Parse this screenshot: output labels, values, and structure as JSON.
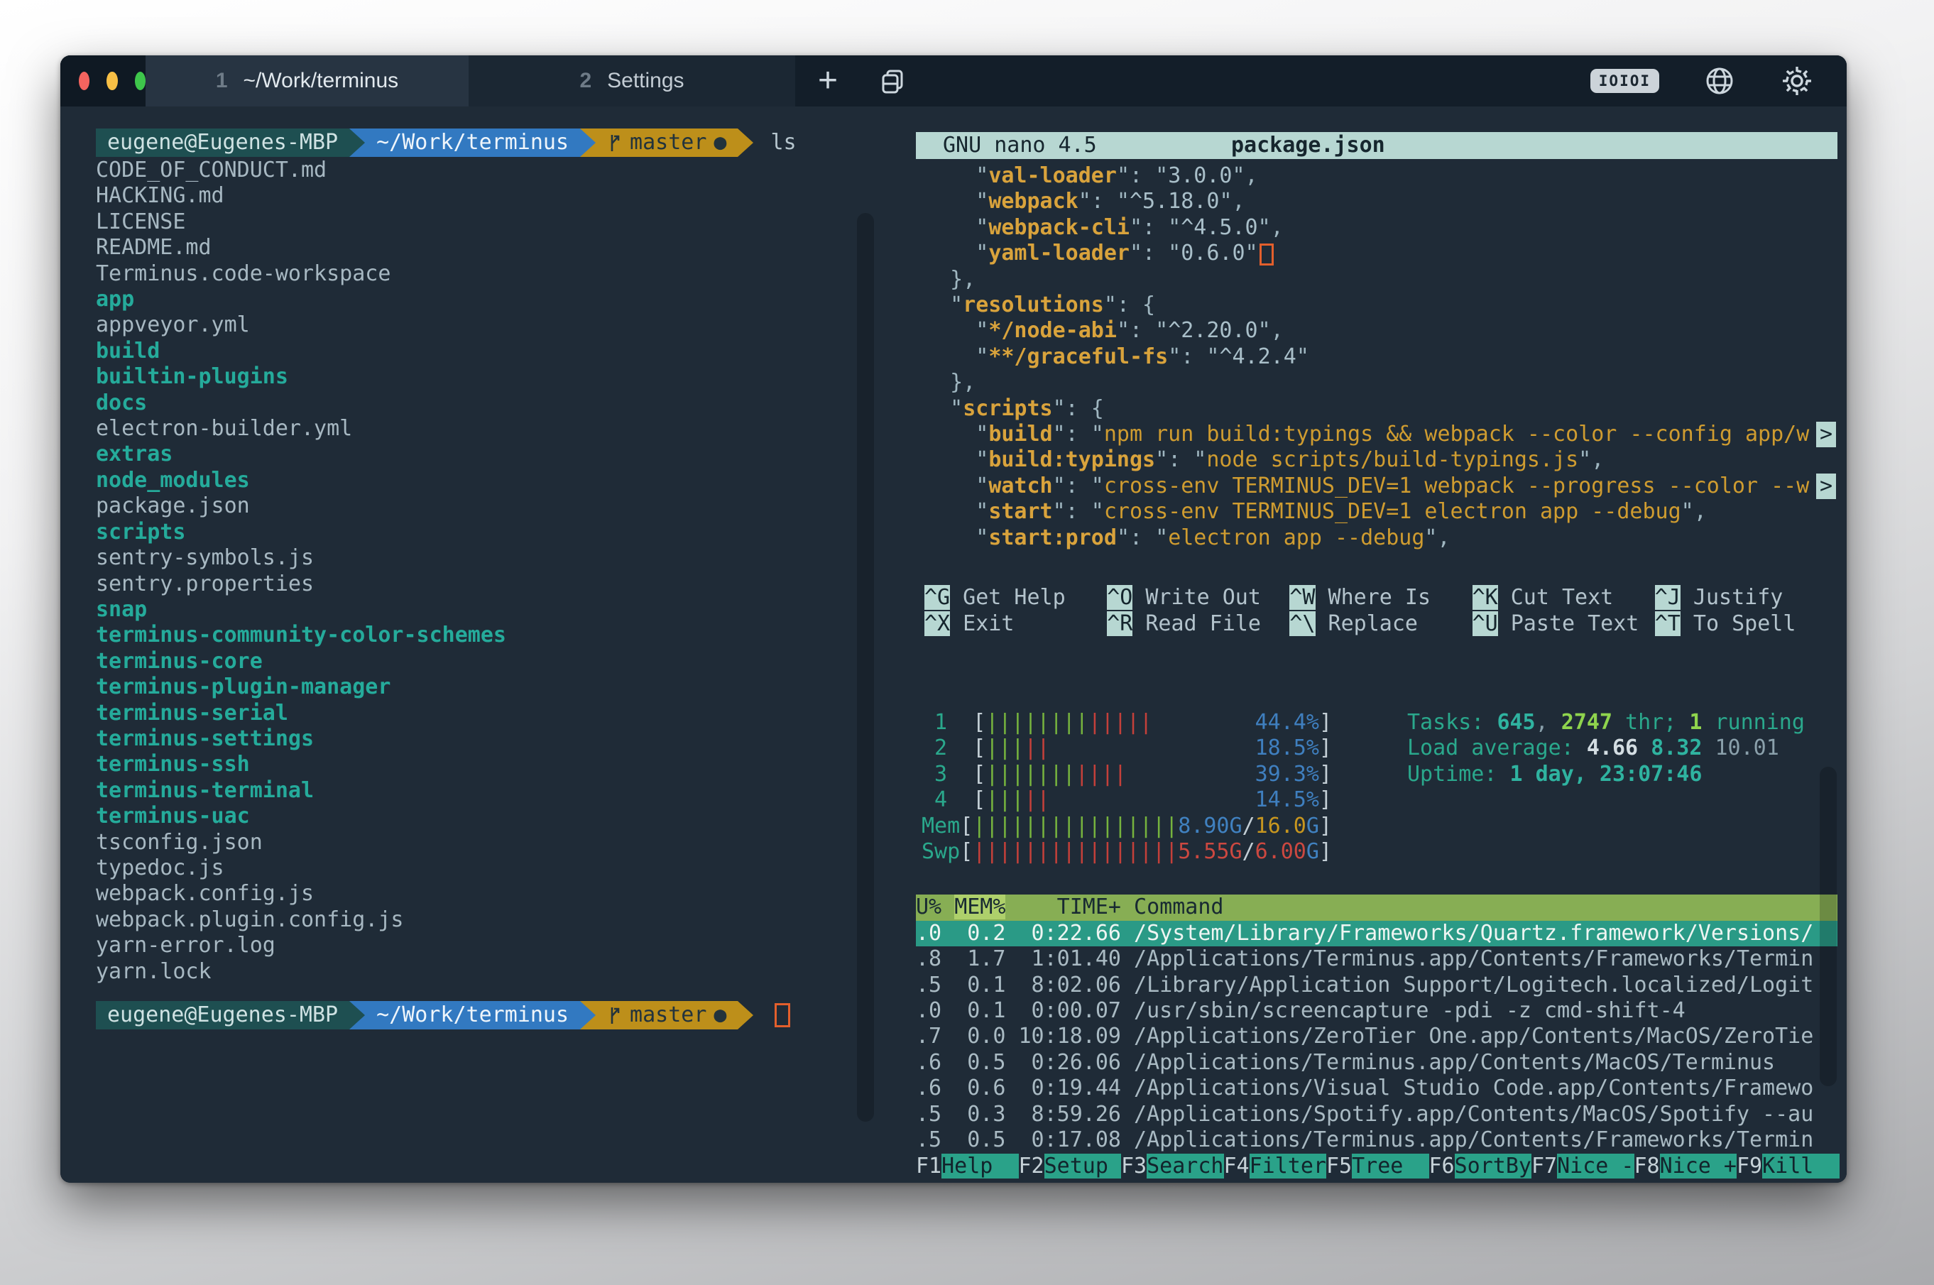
{
  "colors": {
    "accent_teal": "#2aa889",
    "gold": "#bd8f1a",
    "key_gold": "#d9a33c",
    "blue": "#3279c1",
    "red": "#c4403a",
    "green": "#76b33e",
    "bright_green": "#8fd44d",
    "steel_blue": "#3f7fbf",
    "nano_bar": "#b7d7d2",
    "selected_row": "#2a9a86",
    "header_green": "#87ae54",
    "cursor_orange": "#e35f2c",
    "window_bg": "#1f2b37"
  },
  "window": {
    "controls": [
      "close",
      "minimize",
      "zoom"
    ],
    "tabs": [
      {
        "index": "1",
        "label": "~/Work/terminus",
        "active": true
      },
      {
        "index": "2",
        "label": "Settings",
        "active": false
      }
    ],
    "new_tab_label": "+",
    "icons": {
      "serial_badge": "IOIOI",
      "globe": "globe",
      "gear": "settings"
    }
  },
  "shell": {
    "prompt": {
      "user": "eugene@Eugenes-MBP",
      "cwd": "~/Work/terminus",
      "git_branch": "master",
      "git_dirty_dot": "●"
    },
    "command": "ls",
    "listing": [
      {
        "name": "CODE_OF_CONDUCT.md",
        "type": "file"
      },
      {
        "name": "HACKING.md",
        "type": "file"
      },
      {
        "name": "LICENSE",
        "type": "file"
      },
      {
        "name": "README.md",
        "type": "file"
      },
      {
        "name": "Terminus.code-workspace",
        "type": "file"
      },
      {
        "name": "app",
        "type": "dir"
      },
      {
        "name": "appveyor.yml",
        "type": "file"
      },
      {
        "name": "build",
        "type": "dir"
      },
      {
        "name": "builtin-plugins",
        "type": "dir"
      },
      {
        "name": "docs",
        "type": "dir"
      },
      {
        "name": "electron-builder.yml",
        "type": "file"
      },
      {
        "name": "extras",
        "type": "dir"
      },
      {
        "name": "node_modules",
        "type": "dir"
      },
      {
        "name": "package.json",
        "type": "file"
      },
      {
        "name": "scripts",
        "type": "dir"
      },
      {
        "name": "sentry-symbols.js",
        "type": "file"
      },
      {
        "name": "sentry.properties",
        "type": "file"
      },
      {
        "name": "snap",
        "type": "dir"
      },
      {
        "name": "terminus-community-color-schemes",
        "type": "dir"
      },
      {
        "name": "terminus-core",
        "type": "dir"
      },
      {
        "name": "terminus-plugin-manager",
        "type": "dir"
      },
      {
        "name": "terminus-serial",
        "type": "dir"
      },
      {
        "name": "terminus-settings",
        "type": "dir"
      },
      {
        "name": "terminus-ssh",
        "type": "dir"
      },
      {
        "name": "terminus-terminal",
        "type": "dir"
      },
      {
        "name": "terminus-uac",
        "type": "dir"
      },
      {
        "name": "tsconfig.json",
        "type": "file"
      },
      {
        "name": "typedoc.js",
        "type": "file"
      },
      {
        "name": "webpack.config.js",
        "type": "file"
      },
      {
        "name": "webpack.plugin.config.js",
        "type": "file"
      },
      {
        "name": "yarn-error.log",
        "type": "file"
      },
      {
        "name": "yarn.lock",
        "type": "file"
      }
    ]
  },
  "nano": {
    "title_left": "GNU nano 4.5",
    "title_file": "package.json",
    "lines": [
      [
        [
          "q",
          "    \""
        ],
        [
          "k",
          "val-loader"
        ],
        [
          "q",
          "\": \""
        ],
        [
          "v",
          "3.0.0"
        ],
        [
          "q",
          "\","
        ]
      ],
      [
        [
          "q",
          "    \""
        ],
        [
          "k",
          "webpack"
        ],
        [
          "q",
          "\": \""
        ],
        [
          "v",
          "^5.18.0"
        ],
        [
          "q",
          "\","
        ]
      ],
      [
        [
          "q",
          "    \""
        ],
        [
          "k",
          "webpack-cli"
        ],
        [
          "q",
          "\": \""
        ],
        [
          "v",
          "^4.5.0"
        ],
        [
          "q",
          "\","
        ]
      ],
      [
        [
          "q",
          "    \""
        ],
        [
          "k",
          "yaml-loader"
        ],
        [
          "q",
          "\": \""
        ],
        [
          "v",
          "0.6.0"
        ],
        [
          "q",
          "\""
        ],
        [
          "cursor",
          ""
        ]
      ],
      [
        [
          "q",
          "  },"
        ]
      ],
      [
        [
          "q",
          "  \""
        ],
        [
          "k",
          "resolutions"
        ],
        [
          "q",
          "\": {"
        ]
      ],
      [
        [
          "q",
          "    \""
        ],
        [
          "k",
          "*/node-abi"
        ],
        [
          "q",
          "\": \""
        ],
        [
          "v",
          "^2.20.0"
        ],
        [
          "q",
          "\","
        ]
      ],
      [
        [
          "q",
          "    \""
        ],
        [
          "k",
          "**/graceful-fs"
        ],
        [
          "q",
          "\": \""
        ],
        [
          "v",
          "^4.2.4"
        ],
        [
          "q",
          "\""
        ]
      ],
      [
        [
          "q",
          "  },"
        ]
      ],
      [
        [
          "q",
          "  \""
        ],
        [
          "k",
          "scripts"
        ],
        [
          "q",
          "\": {"
        ]
      ],
      [
        [
          "q",
          "    \""
        ],
        [
          "k",
          "build"
        ],
        [
          "q",
          "\": \""
        ],
        [
          "g",
          "npm run build:typings && webpack --color --config app/w"
        ],
        [
          "cont",
          ""
        ]
      ],
      [
        [
          "q",
          "    \""
        ],
        [
          "k",
          "build:typings"
        ],
        [
          "q",
          "\": \""
        ],
        [
          "g",
          "node scripts/build-typings.js"
        ],
        [
          "q",
          "\","
        ]
      ],
      [
        [
          "q",
          "    \""
        ],
        [
          "k",
          "watch"
        ],
        [
          "q",
          "\": \""
        ],
        [
          "g",
          "cross-env TERMINUS_DEV=1 webpack --progress --color --w"
        ],
        [
          "cont",
          ""
        ]
      ],
      [
        [
          "q",
          "    \""
        ],
        [
          "k",
          "start"
        ],
        [
          "q",
          "\": \""
        ],
        [
          "g",
          "cross-env TERMINUS_DEV=1 electron app --debug"
        ],
        [
          "q",
          "\","
        ]
      ],
      [
        [
          "q",
          "    \""
        ],
        [
          "k",
          "start:prod"
        ],
        [
          "q",
          "\": \""
        ],
        [
          "g",
          "electron app --debug"
        ],
        [
          "q",
          "\","
        ]
      ]
    ],
    "shortcuts": [
      [
        {
          "key": "^G",
          "label": "Get Help"
        },
        {
          "key": "^O",
          "label": "Write Out"
        },
        {
          "key": "^W",
          "label": "Where Is"
        },
        {
          "key": "^K",
          "label": "Cut Text"
        },
        {
          "key": "^J",
          "label": "Justify"
        }
      ],
      [
        {
          "key": "^X",
          "label": "Exit"
        },
        {
          "key": "^R",
          "label": "Read File"
        },
        {
          "key": "^\\",
          "label": "Replace"
        },
        {
          "key": "^U",
          "label": "Paste Text"
        },
        {
          "key": "^T",
          "label": "To Spell"
        }
      ]
    ]
  },
  "htop": {
    "meters": [
      {
        "parts": [
          [
            "L",
            " 1  "
          ],
          [
            "W",
            "["
          ],
          [
            "G",
            "||||||||"
          ],
          [
            "R",
            "|||||"
          ],
          [
            "W",
            "        "
          ],
          [
            "P",
            "44.4%"
          ],
          [
            "W",
            "]"
          ]
        ]
      },
      {
        "parts": [
          [
            "L",
            " 2  "
          ],
          [
            "W",
            "["
          ],
          [
            "G",
            "|||"
          ],
          [
            "R",
            "||"
          ],
          [
            "W",
            "                "
          ],
          [
            "P",
            "18.5%"
          ],
          [
            "W",
            "]"
          ]
        ]
      },
      {
        "parts": [
          [
            "L",
            " 3  "
          ],
          [
            "W",
            "["
          ],
          [
            "G",
            "|||||||"
          ],
          [
            "R",
            "||||"
          ],
          [
            "W",
            "          "
          ],
          [
            "P",
            "39.3%"
          ],
          [
            "W",
            "]"
          ]
        ]
      },
      {
        "parts": [
          [
            "L",
            " 4  "
          ],
          [
            "W",
            "["
          ],
          [
            "G",
            "|||"
          ],
          [
            "R",
            "||"
          ],
          [
            "W",
            "                "
          ],
          [
            "P",
            "14.5%"
          ],
          [
            "W",
            "]"
          ]
        ]
      },
      {
        "parts": [
          [
            "L",
            "Mem"
          ],
          [
            "W",
            "["
          ],
          [
            "G",
            "||||||||||||||||"
          ],
          [
            "B",
            "8.90G"
          ],
          [
            "W",
            "/"
          ],
          [
            "Y",
            "16.0"
          ],
          [
            "B",
            "G"
          ],
          [
            "W",
            "]"
          ]
        ]
      },
      {
        "parts": [
          [
            "L",
            "Swp"
          ],
          [
            "W",
            "["
          ],
          [
            "R",
            "||||||||||||||||"
          ],
          [
            "D",
            "5.55G"
          ],
          [
            "W",
            "/"
          ],
          [
            "D",
            "6.00"
          ],
          [
            "B",
            "G"
          ],
          [
            "W",
            "]"
          ]
        ]
      }
    ],
    "summary": [
      [
        [
          "tl",
          "Tasks: "
        ],
        [
          "tb",
          "645"
        ],
        [
          "gr",
          ", "
        ],
        [
          "gb",
          "2747"
        ],
        [
          "tl",
          " thr; "
        ],
        [
          "gb",
          "1"
        ],
        [
          "tl",
          " running"
        ]
      ],
      [
        [
          "tl",
          "Load average: "
        ],
        [
          "wb",
          "4.66 "
        ],
        [
          "tb",
          "8.32 "
        ],
        [
          "gr",
          "10.01"
        ]
      ],
      [
        [
          "tl",
          "Uptime: "
        ],
        [
          "tb",
          "1 day, 23:07:46"
        ]
      ]
    ],
    "table": {
      "header": {
        "col_cpu": "U%",
        "col_mem": "MEM%",
        "col_time": "TIME+",
        "col_cmd": "Command",
        "sort_col": "MEM%"
      },
      "selected_index": 0,
      "rows": [
        {
          "cpu": ".0",
          "mem": "0.2",
          "time": "0:22.66",
          "cmd": "/System/Library/Frameworks/Quartz.framework/Versions/"
        },
        {
          "cpu": ".8",
          "mem": "1.7",
          "time": "1:01.40",
          "cmd": "/Applications/Terminus.app/Contents/Frameworks/Termin"
        },
        {
          "cpu": ".5",
          "mem": "0.1",
          "time": "8:02.06",
          "cmd": "/Library/Application Support/Logitech.localized/Logit"
        },
        {
          "cpu": ".0",
          "mem": "0.1",
          "time": "0:00.07",
          "cmd": "/usr/sbin/screencapture -pdi -z cmd-shift-4"
        },
        {
          "cpu": ".7",
          "mem": "0.0",
          "time": "10:18.09",
          "cmd": "/Applications/ZeroTier One.app/Contents/MacOS/ZeroTie"
        },
        {
          "cpu": ".6",
          "mem": "0.5",
          "time": "0:26.06",
          "cmd": "/Applications/Terminus.app/Contents/MacOS/Terminus"
        },
        {
          "cpu": ".6",
          "mem": "0.6",
          "time": "0:19.44",
          "cmd": "/Applications/Visual Studio Code.app/Contents/Framewo"
        },
        {
          "cpu": ".5",
          "mem": "0.3",
          "time": "8:59.26",
          "cmd": "/Applications/Spotify.app/Contents/MacOS/Spotify --au"
        },
        {
          "cpu": ".5",
          "mem": "0.5",
          "time": "0:17.08",
          "cmd": "/Applications/Terminus.app/Contents/Frameworks/Termin"
        }
      ]
    },
    "fkeys": [
      {
        "key": "F1",
        "label": "Help  "
      },
      {
        "key": "F2",
        "label": "Setup "
      },
      {
        "key": "F3",
        "label": "Search"
      },
      {
        "key": "F4",
        "label": "Filter"
      },
      {
        "key": "F5",
        "label": "Tree  "
      },
      {
        "key": "F6",
        "label": "SortBy"
      },
      {
        "key": "F7",
        "label": "Nice -"
      },
      {
        "key": "F8",
        "label": "Nice +"
      },
      {
        "key": "F9",
        "label": "Kill  "
      }
    ]
  }
}
